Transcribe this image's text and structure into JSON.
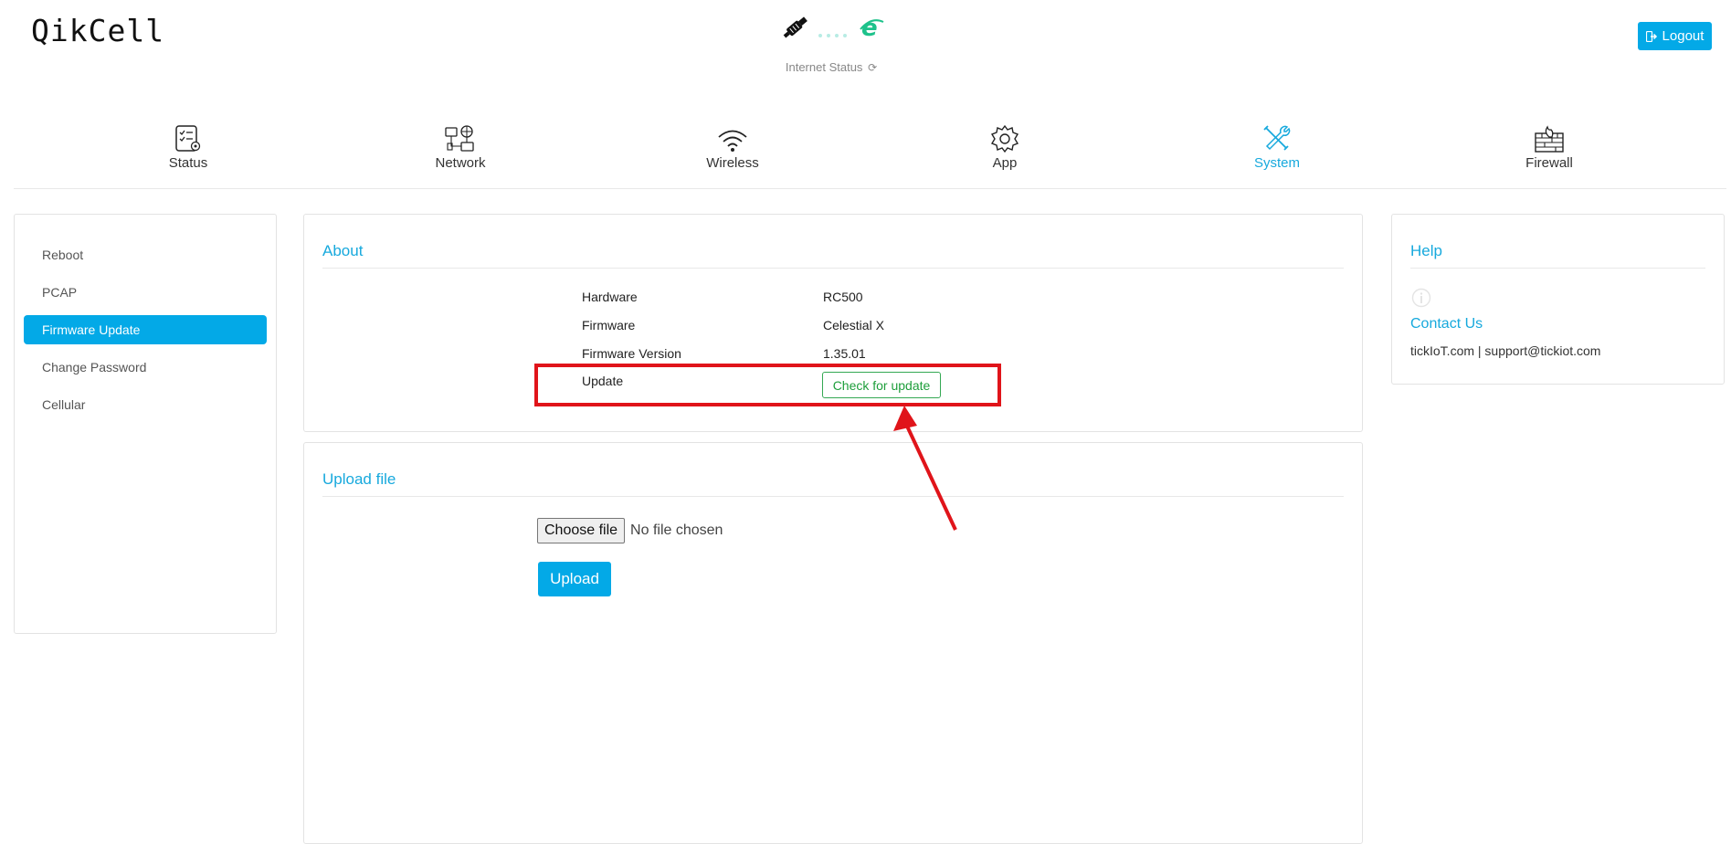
{
  "brand": "QikCell",
  "internet_status": {
    "label": "Internet Status",
    "connected_color": "#1ec28b",
    "refresh_icon": "refresh-icon"
  },
  "logout": {
    "label": "Logout",
    "icon": "sign-out-icon"
  },
  "nav": {
    "items": [
      {
        "label": "Status",
        "icon": "checklist-gear-icon",
        "active": false
      },
      {
        "label": "Network",
        "icon": "network-devices-icon",
        "active": false
      },
      {
        "label": "Wireless",
        "icon": "wifi-icon",
        "active": false
      },
      {
        "label": "App",
        "icon": "gear-icon",
        "active": false
      },
      {
        "label": "System",
        "icon": "tools-icon",
        "active": true
      },
      {
        "label": "Firewall",
        "icon": "firewall-icon",
        "active": false
      }
    ]
  },
  "sidebar": {
    "items": [
      {
        "label": "Reboot",
        "active": false
      },
      {
        "label": "PCAP",
        "active": false
      },
      {
        "label": "Firmware Update",
        "active": true
      },
      {
        "label": "Change Password",
        "active": false
      },
      {
        "label": "Cellular",
        "active": false
      }
    ]
  },
  "about": {
    "title": "About",
    "rows": [
      {
        "key": "Hardware",
        "value": "RC500"
      },
      {
        "key": "Firmware",
        "value": "Celestial X"
      },
      {
        "key": "Firmware Version",
        "value": "1.35.01"
      }
    ],
    "update_label": "Update",
    "check_button": "Check for update"
  },
  "upload": {
    "title": "Upload file",
    "choose_button": "Choose file",
    "no_file_text": "No file chosen",
    "upload_button": "Upload"
  },
  "help": {
    "title": "Help",
    "contact_title": "Contact Us",
    "contact_text": "tickIoT.com | support@tickiot.com"
  },
  "colors": {
    "accent": "#03a9e7",
    "annotation": "#e0141a",
    "success": "#34a853"
  }
}
